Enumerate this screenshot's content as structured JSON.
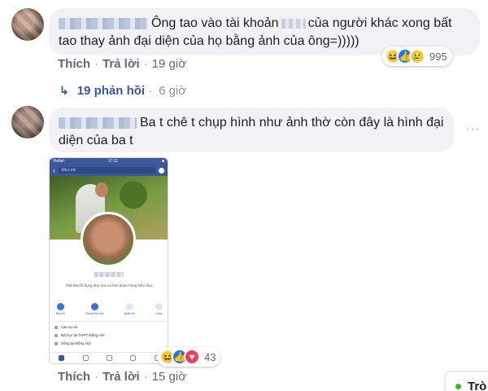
{
  "comment1": {
    "text_before": "Ông tao vào tài khoản",
    "text_after": "của người khác xong bất tao thay ảnh đại diện của họ bằng ảnh của ông=)))))",
    "actions": {
      "like": "Thích",
      "reply": "Trả lời",
      "time": "19 giờ"
    },
    "reactions": {
      "icons": [
        "haha-icon",
        "like-icon",
        "sad-icon"
      ],
      "count": "995"
    },
    "replies": {
      "label": "19 phản hồi",
      "time": "6 giờ"
    }
  },
  "comment2": {
    "text": "Ba t chê t chụp hình như ảnh thờ còn đây là hình đại diện của ba t",
    "more": "···",
    "screenshot": {
      "status_left": "Viettel",
      "status_time": "17:11",
      "search_text": "Ma Leki",
      "bio": "thật thà,tốt bụng đẹp trai vui tính đoan trang hiền thục",
      "actions": [
        "Bạn bè",
        "Đang theo dõi",
        "Nhắn tin",
        "Khác"
      ],
      "info": [
        "Làm tự do",
        "Đã học tại THPT Đồng Hới",
        "Sống tại Đồng Hới"
      ]
    },
    "actions": {
      "like": "Thích",
      "reply": "Trả lời",
      "time": "15 giờ"
    },
    "reactions": {
      "icons": [
        "haha-icon",
        "like-icon",
        "love-icon"
      ],
      "count": "43"
    }
  },
  "chat": {
    "label": "Trò"
  },
  "colors": {
    "link": "#385898",
    "bubble": "#f0f2f5",
    "online": "#42b72a",
    "like": "#1877f2"
  }
}
